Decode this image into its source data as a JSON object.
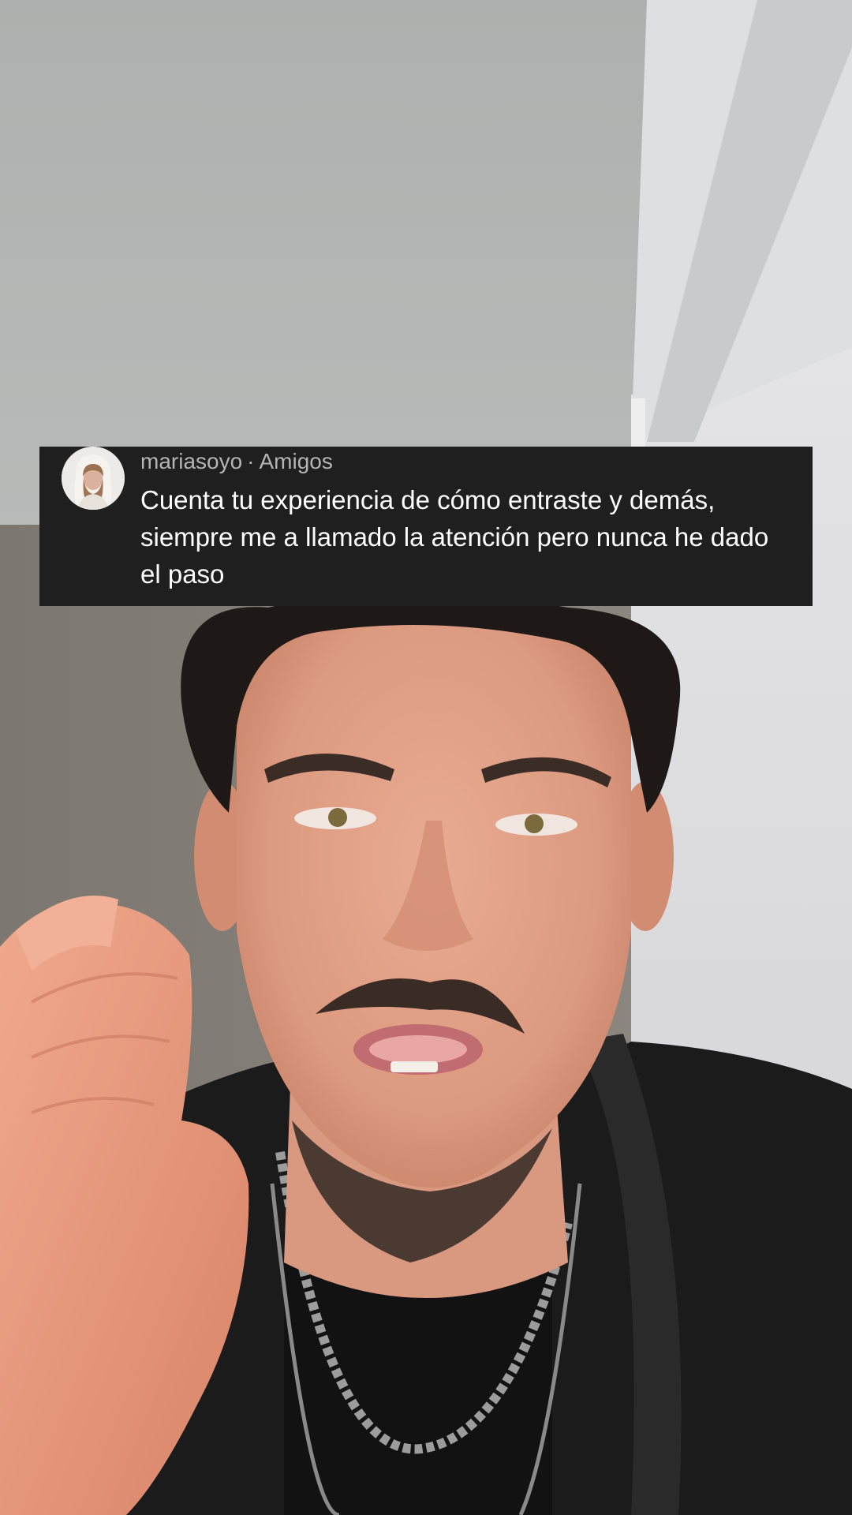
{
  "reply_banner": {
    "username": "mariasoyo",
    "separator": "·",
    "relationship": "Amigos",
    "comment": "Cuenta tu experiencia de cómo entraste y demás, siempre me a llamado la atención pero nunca he dado el paso"
  },
  "icons": {
    "avatar": "commenter-avatar-photo"
  },
  "colors": {
    "banner_background": "#1f1f1f",
    "meta_text": "#b4b4b4",
    "comment_text": "#ffffff"
  }
}
